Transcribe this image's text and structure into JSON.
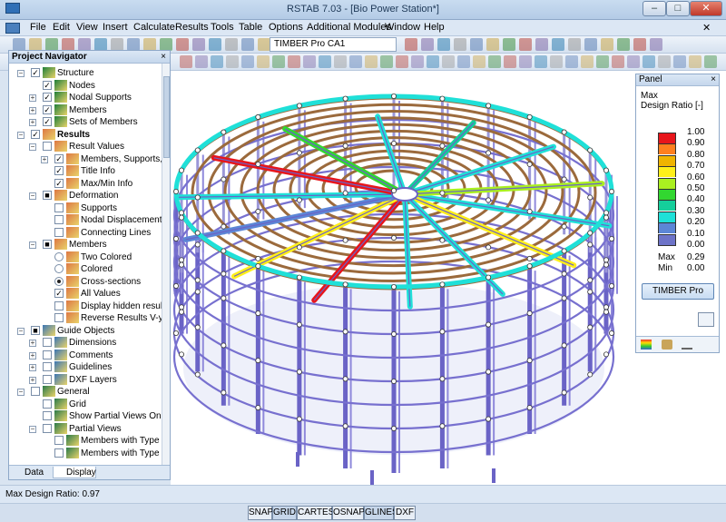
{
  "window": {
    "title": "RSTAB 7.03 - [Bio Power Station*]"
  },
  "menu": [
    "File",
    "Edit",
    "View",
    "Insert",
    "Calculate",
    "Results",
    "Tools",
    "Table",
    "Options",
    "Additional Modules",
    "Window",
    "Help"
  ],
  "toolbar": {
    "case_select": "TIMBER Pro CA1"
  },
  "navigator": {
    "title": "Project Navigator",
    "close": "×",
    "items": [
      {
        "label": "Structure",
        "bold": false
      },
      {
        "label": "Nodes"
      },
      {
        "label": "Nodal Supports"
      },
      {
        "label": "Members"
      },
      {
        "label": "Sets of Members"
      },
      {
        "label": "Results",
        "bold": true
      },
      {
        "label": "Result Values"
      },
      {
        "label": "Members, Supports, S"
      },
      {
        "label": "Title Info"
      },
      {
        "label": "Max/Min Info"
      },
      {
        "label": "Deformation"
      },
      {
        "label": "Supports"
      },
      {
        "label": "Nodal Displacements"
      },
      {
        "label": "Connecting Lines"
      },
      {
        "label": "Members"
      },
      {
        "label": "Two Colored"
      },
      {
        "label": "Colored"
      },
      {
        "label": "Cross-sections"
      },
      {
        "label": "All Values"
      },
      {
        "label": "Display hidden result"
      },
      {
        "label": "Reverse Results V-y ar"
      },
      {
        "label": "Guide Objects"
      },
      {
        "label": "Dimensions"
      },
      {
        "label": "Comments"
      },
      {
        "label": "Guidelines"
      },
      {
        "label": "DXF Layers"
      },
      {
        "label": "General"
      },
      {
        "label": "Grid"
      },
      {
        "label": "Show Partial Views Only"
      },
      {
        "label": "Partial Views"
      },
      {
        "label": "Members with Type 'E"
      },
      {
        "label": "Members with Type 'T"
      }
    ],
    "tabs": {
      "data": "Data",
      "display": "Display"
    }
  },
  "panel": {
    "title": "Panel",
    "close": "×",
    "heading1": "Max",
    "heading2": "Design Ratio [-]",
    "legend": [
      {
        "value": "1.00",
        "color": "#e8151b"
      },
      {
        "value": "0.90",
        "color": "#ff7f1e"
      },
      {
        "value": "0.80",
        "color": "#f0b400"
      },
      {
        "value": "0.70",
        "color": "#ffef1a"
      },
      {
        "value": "0.60",
        "color": "#aaf020"
      },
      {
        "value": "0.50",
        "color": "#32d730"
      },
      {
        "value": "0.40",
        "color": "#15cf9b"
      },
      {
        "value": "0.30",
        "color": "#1fe0d8"
      },
      {
        "value": "0.20",
        "color": "#5c86d6"
      },
      {
        "value": "0.10",
        "color": "#6d73c8"
      },
      {
        "value": "0.00",
        "color": "#6d73c8"
      }
    ],
    "max_label": "Max",
    "max_value": "0.29",
    "min_label": "Min",
    "min_value": "0.00",
    "button": "TIMBER Pro"
  },
  "status": {
    "text": "Max Design Ratio: 0.97"
  },
  "statusbuttons": [
    "SNAP",
    "GRID",
    "CARTES",
    "OSNAP",
    "GLINES",
    "DXF"
  ]
}
